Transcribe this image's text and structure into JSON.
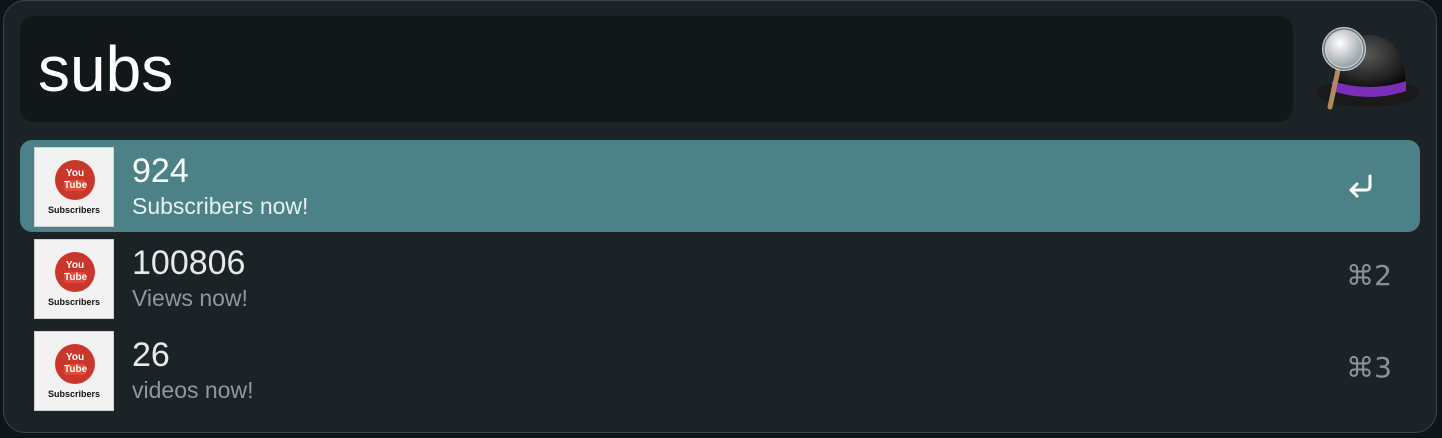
{
  "search": {
    "query": "subs",
    "placeholder": ""
  },
  "app_icon": "alfred-hat-magnifier-icon",
  "thumbnail": {
    "you": "You",
    "tube": "Tube",
    "label": "Subscribers"
  },
  "results": [
    {
      "title": "924",
      "subtitle": "Subscribers now!",
      "shortcut": "",
      "selected": true,
      "action_icon": "return-icon"
    },
    {
      "title": "100806",
      "subtitle": "Views now!",
      "shortcut": "⌘2",
      "selected": false
    },
    {
      "title": "26",
      "subtitle": "videos now!",
      "shortcut": "⌘3",
      "selected": false
    }
  ],
  "colors": {
    "window_bg": "#1c2326",
    "selected_row": "#4d8188",
    "youtube_red": "#c9362b",
    "hat_band": "#7b2fb8"
  }
}
